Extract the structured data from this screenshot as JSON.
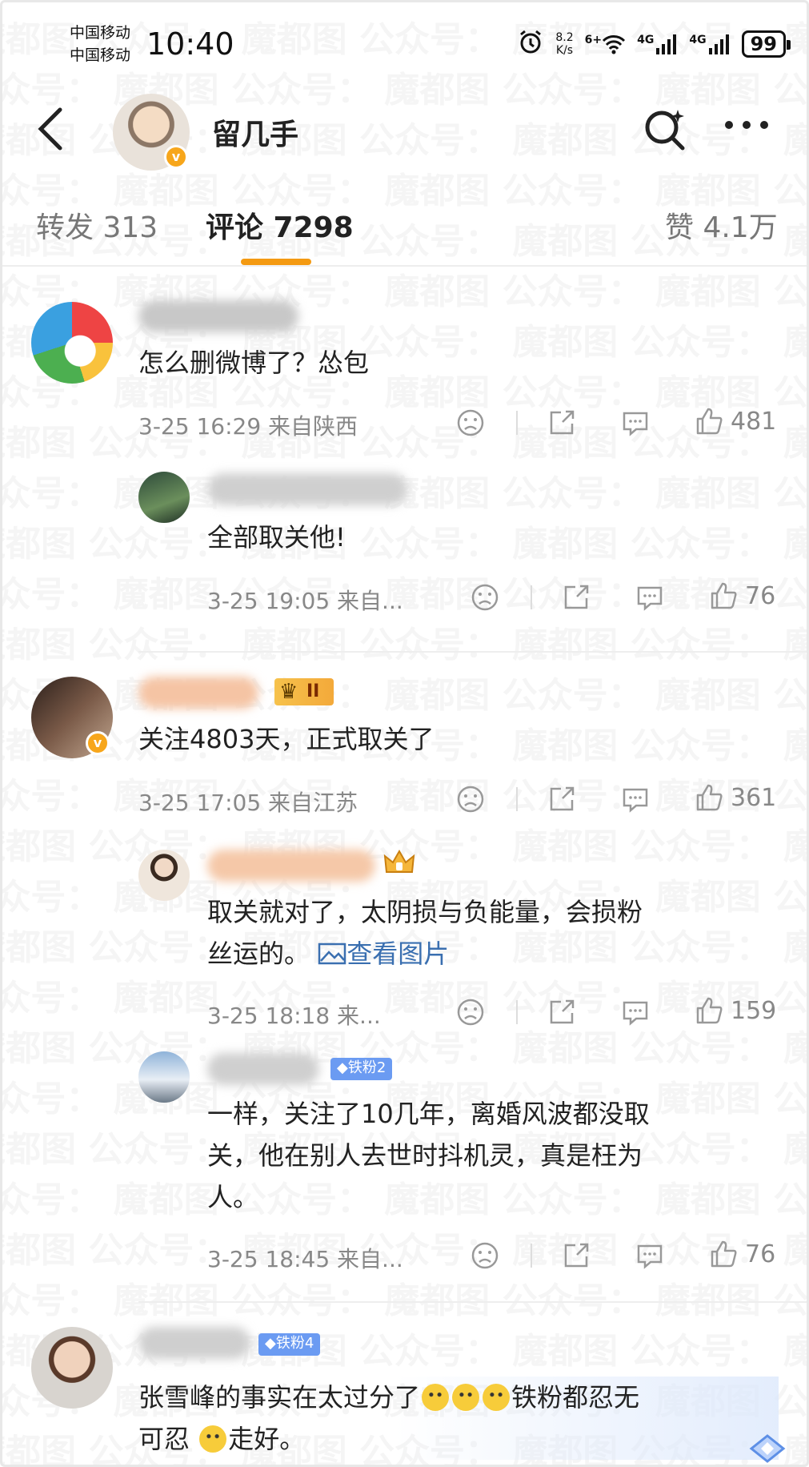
{
  "status_bar": {
    "carrier1": "中国移动",
    "carrier2": "中国移动",
    "time": "10:40",
    "net_speed_value": "8.2",
    "net_speed_unit": "K/s",
    "wifi_label": "6+",
    "signal1": "4G",
    "signal2": "4G",
    "battery": "99"
  },
  "header": {
    "back_icon": "chevron-left-icon",
    "name": "留几手",
    "search_icon": "search-sparkle-icon",
    "more_icon": "more-dots-icon"
  },
  "tabs": [
    {
      "label": "转发 313"
    },
    {
      "label": "评论 7298",
      "active": true
    },
    {
      "label": "赞 4.1万"
    }
  ],
  "comments": [
    {
      "text": "怎么删微博了？怂包",
      "meta": "3-25 16:29 来自陕西",
      "likes": "481",
      "reply": {
        "text": "全部取关他!",
        "meta": "3-25 19:05 来自...",
        "likes": "76"
      }
    },
    {
      "badge": "II",
      "text": "关注4803天，正式取关了",
      "meta": "3-25 17:05 来自江苏",
      "likes": "361",
      "replies": [
        {
          "text_line1": "取关就对了，太阴损与负能量，会损粉",
          "text_line2": "丝运的。",
          "link": "查看图片",
          "meta": "3-25 18:18 来...",
          "likes": "159"
        },
        {
          "fan_badge": "铁粉2",
          "text_line1": "一样，关注了10几年，离婚风波都没取",
          "text_line2": "关，他在别人去世时抖机灵，真是枉为",
          "text_line3": "人。",
          "meta": "3-25 18:45 来自...",
          "likes": "76"
        }
      ]
    },
    {
      "fan_badge": "铁粉4",
      "text_part1": "张雪峰的事实在太过分了",
      "text_part2": "铁粉都忍无",
      "text_line2_part1": "可忍",
      "text_line2_part2": "走好。"
    }
  ],
  "watermark": "魔都图 公众号："
}
